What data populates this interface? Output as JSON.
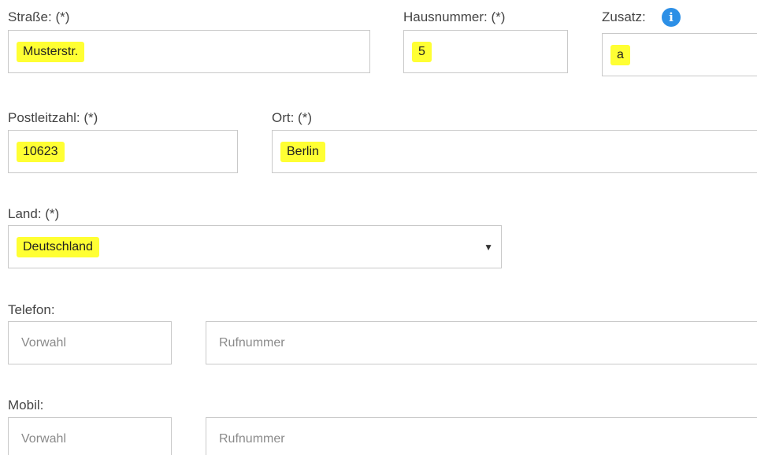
{
  "address": {
    "street": {
      "label": "Straße: (*)",
      "value": "Musterstr."
    },
    "house_number": {
      "label": "Hausnummer: (*)",
      "value": "5"
    },
    "addition": {
      "label": "Zusatz:",
      "value": "a",
      "icon": "info-icon"
    },
    "postal_code": {
      "label": "Postleitzahl: (*)",
      "value": "10623"
    },
    "city": {
      "label": "Ort: (*)",
      "value": "Berlin"
    },
    "country": {
      "label": "Land: (*)",
      "value": "Deutschland",
      "icon": "dropdown-arrow-icon",
      "arrow_glyph": "▼"
    }
  },
  "phone": {
    "label": "Telefon:",
    "area_placeholder": "Vorwahl",
    "number_placeholder": "Rufnummer"
  },
  "mobile": {
    "label": "Mobil:",
    "area_placeholder": "Vorwahl",
    "number_placeholder": "Rufnummer"
  },
  "colors": {
    "highlight": "#ffff33",
    "info_icon": "#2c8fe6",
    "border": "#c9c9c9"
  }
}
